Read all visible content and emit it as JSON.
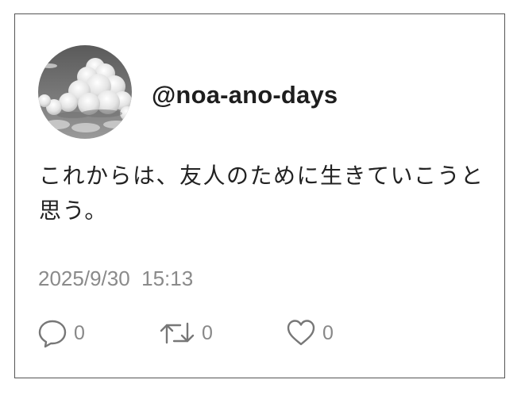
{
  "post": {
    "handle": "@noa-ano-days",
    "text": "これからは、友人のために生きていこうと思う。",
    "timestamp": "2025/9/30  15:13",
    "avatar_icon": "cloud-sky-avatar"
  },
  "actions": {
    "reply": {
      "icon": "reply-icon",
      "count": "0"
    },
    "retweet": {
      "icon": "retweet-icon",
      "count": "0"
    },
    "like": {
      "icon": "heart-icon",
      "count": "0"
    }
  },
  "colors": {
    "border": "#555555",
    "text": "#222222",
    "muted": "#8a8a8a"
  }
}
